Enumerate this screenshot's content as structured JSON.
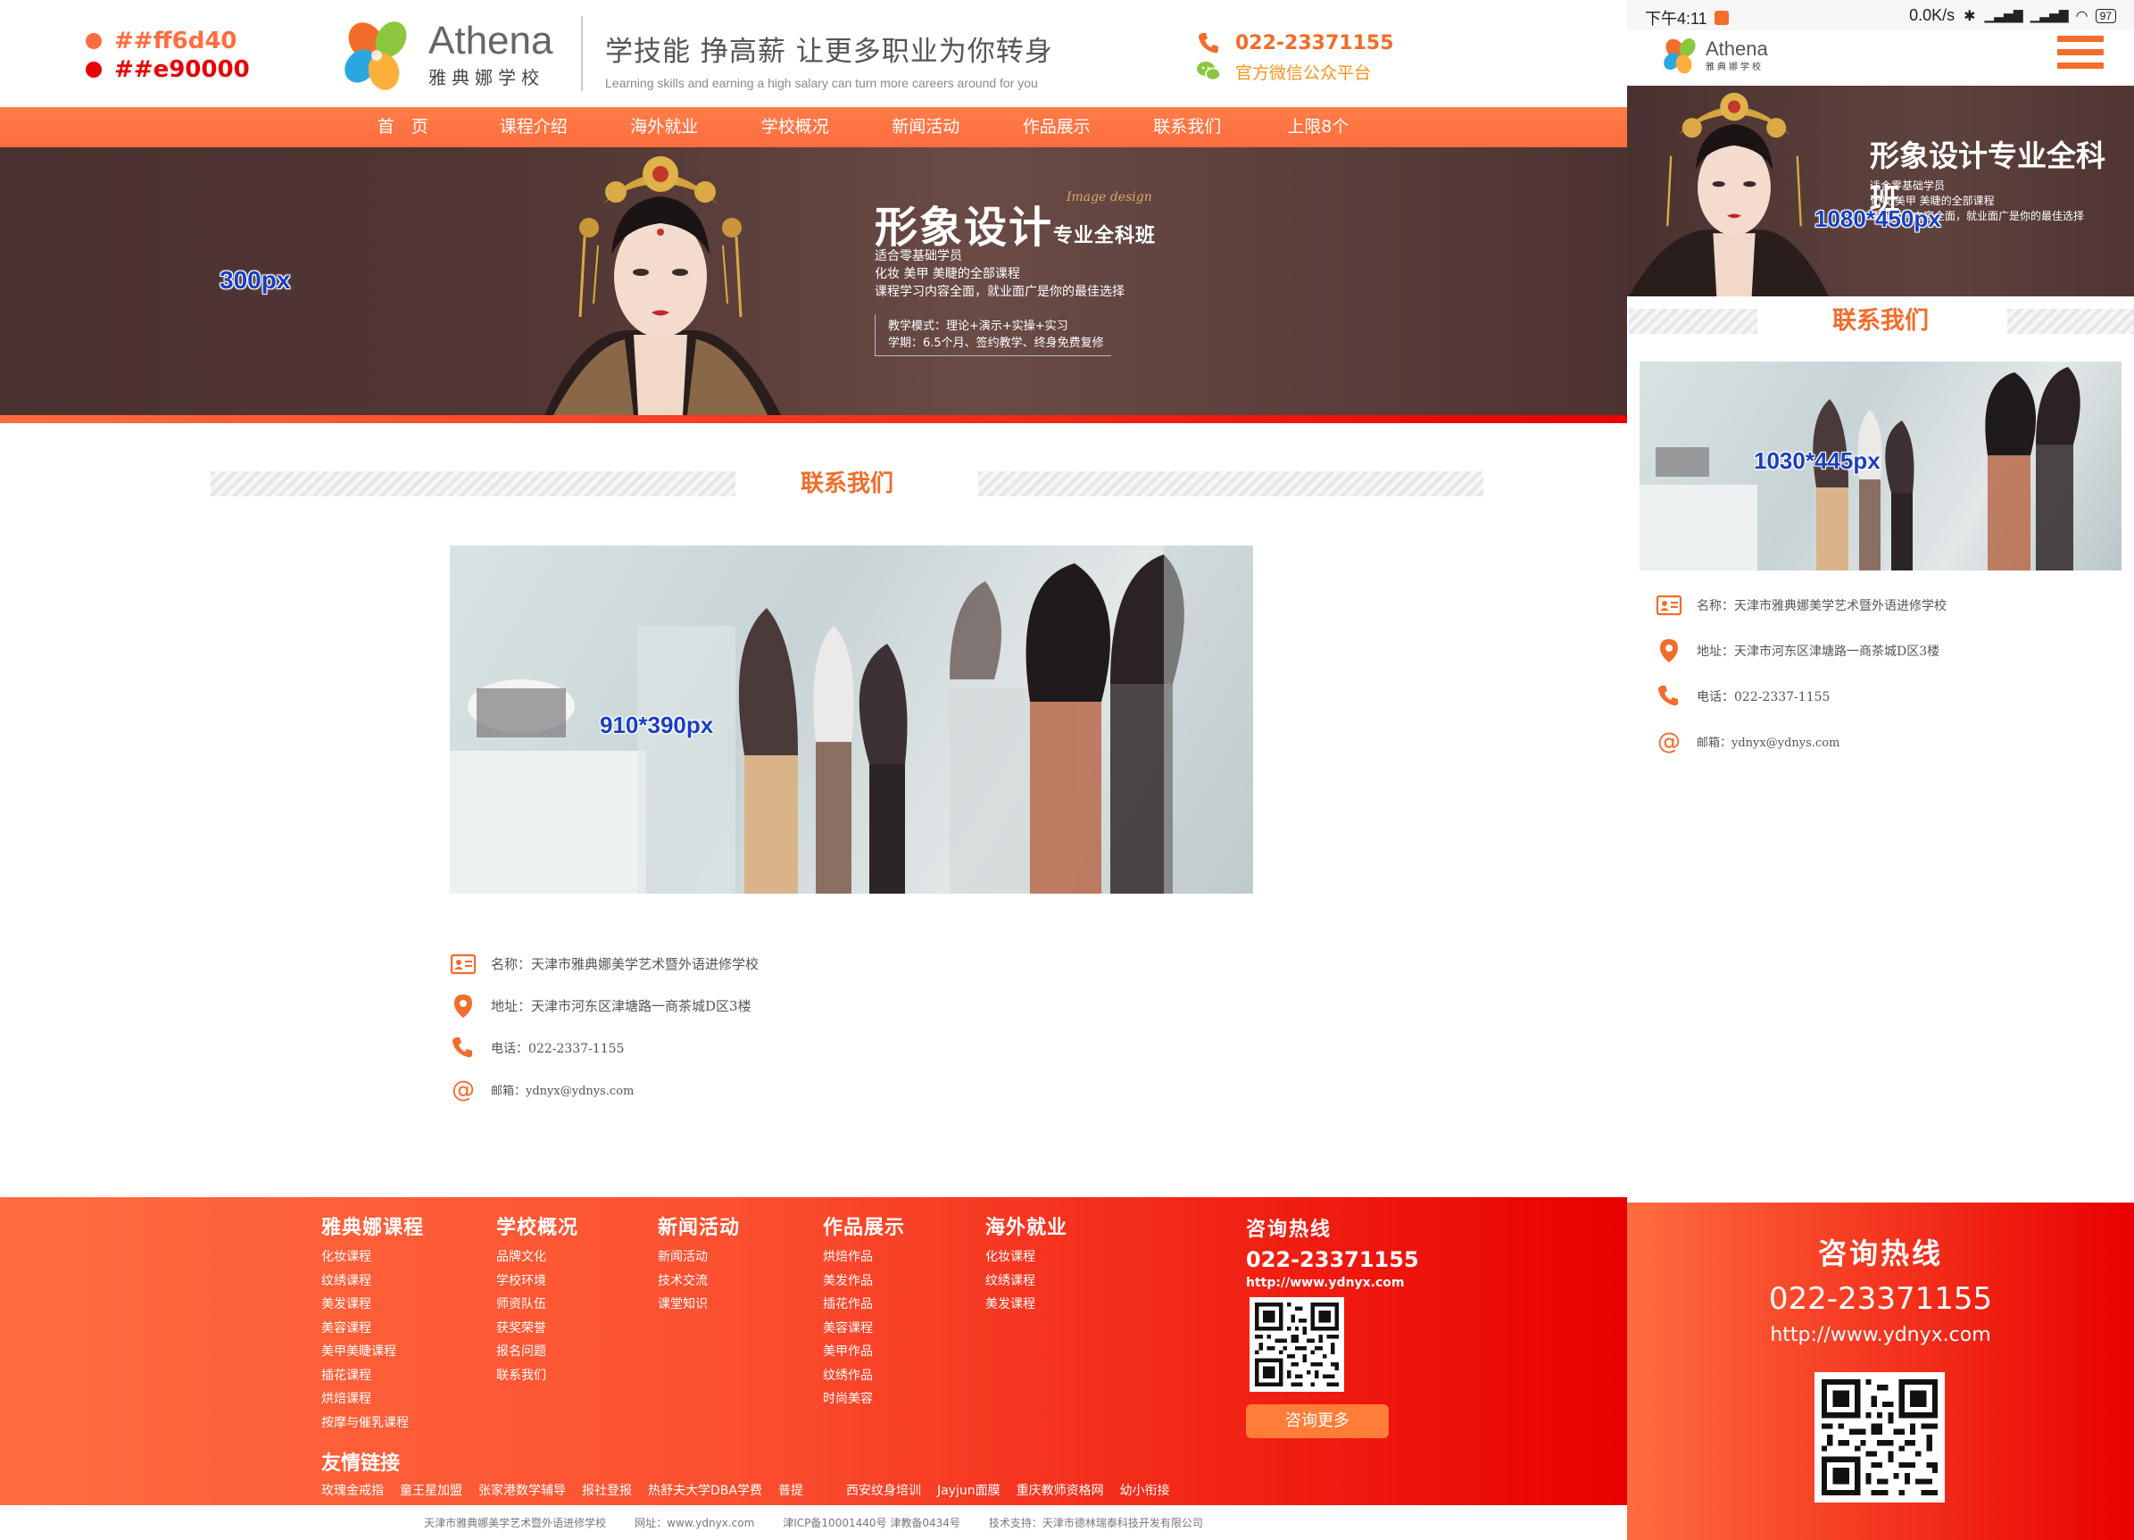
{
  "swatches": [
    "##ff6d40",
    "##e90000"
  ],
  "colors": {
    "primary": "#ff6d40",
    "secondary": "#e90000",
    "accent": "#f26c2a"
  },
  "brand": {
    "name_en": "Athena",
    "name_cn": "雅典娜学校"
  },
  "slogan": {
    "cn": "学技能 挣高薪 让更多职业为你转身",
    "en": "Learning skills and earning a high salary can turn more careers around for you"
  },
  "header_contact": {
    "phone": "022-23371155",
    "wechat": "官方微信公众平台"
  },
  "nav": [
    "首　页",
    "课程介绍",
    "海外就业",
    "学校概况",
    "新闻活动",
    "作品展示",
    "联系我们",
    "上限8个"
  ],
  "banner": {
    "size_label": "300px",
    "title": "形象设计",
    "title_suffix": "专业全科班",
    "script": "Image design",
    "lines": [
      "适合零基础学员",
      "化妆 美甲 美睫的全部课程",
      "课程学习内容全面，就业面广是你的最佳选择"
    ],
    "mode_lines": [
      "教学模式：理论+演示+实操+实习",
      "学期：6.5个月、签约教学、终身免费复修"
    ]
  },
  "section_title": "联系我们",
  "photo_size_label": "910*390px",
  "contact_info": [
    {
      "icon": "id-card-icon",
      "label": "名称：",
      "value": "天津市雅典娜美学艺术暨外语进修学校"
    },
    {
      "icon": "location-pin-icon",
      "label": "地址：",
      "value": "天津市河东区津塘路一商茶城D区3楼"
    },
    {
      "icon": "phone-icon",
      "label": "电话：",
      "value": "022-2337-1155"
    },
    {
      "icon": "at-icon",
      "label": "邮箱：",
      "value": "ydnyx@ydnys.com"
    }
  ],
  "footer": {
    "columns": [
      {
        "title": "雅典娜课程",
        "items": [
          "化妆课程",
          "纹绣课程",
          "美发课程",
          "美容课程",
          "美甲美睫课程",
          "插花课程",
          "烘焙课程",
          "按摩与催乳课程"
        ]
      },
      {
        "title": "学校概况",
        "items": [
          "品牌文化",
          "学校环境",
          "师资队伍",
          "获奖荣誉",
          "报名问题",
          "联系我们"
        ]
      },
      {
        "title": "新闻活动",
        "items": [
          "新闻活动",
          "技术交流",
          "课堂知识"
        ]
      },
      {
        "title": "作品展示",
        "items": [
          "烘焙作品",
          "美发作品",
          "插花作品",
          "美容课程",
          "美甲作品",
          "纹绣作品",
          "时尚美容"
        ]
      },
      {
        "title": "海外就业",
        "items": [
          "化妆课程",
          "纹绣课程",
          "美发课程"
        ]
      }
    ],
    "hotline_title": "咨询热线",
    "hotline_number": "022-23371155",
    "website": "http://www.ydnyx.com",
    "more_button": "咨询更多",
    "friends_title": "友情链接",
    "friend_links": [
      "玫瑰金戒指",
      "童王星加盟",
      "张家港数学辅导",
      "报社登报",
      "热舒夫大学DBA学费",
      "普提",
      "西安纹身培训",
      "Jayjun面膜",
      "重庆教师资格网",
      "幼小衔接"
    ]
  },
  "copyright": [
    "天津市雅典娜美学艺术暨外语进修学校",
    "网址：www.ydnyx.com",
    "津ICP备10001440号 津教备0434号",
    "技术支持：天津市德林瑞泰科技开发有限公司"
  ],
  "mobile": {
    "status_time": "下午4:11",
    "status_speed": "0.0K/s",
    "battery": "97",
    "banner_title": "形象设计专业全科班",
    "banner_lines": [
      "适合零基础学员",
      "化妆 美甲 美睫的全部课程",
      "课程学习内容全面，就业面广是你的最佳选择"
    ],
    "banner_size_label": "1080*450px",
    "photo_size_label": "1030*445px"
  }
}
